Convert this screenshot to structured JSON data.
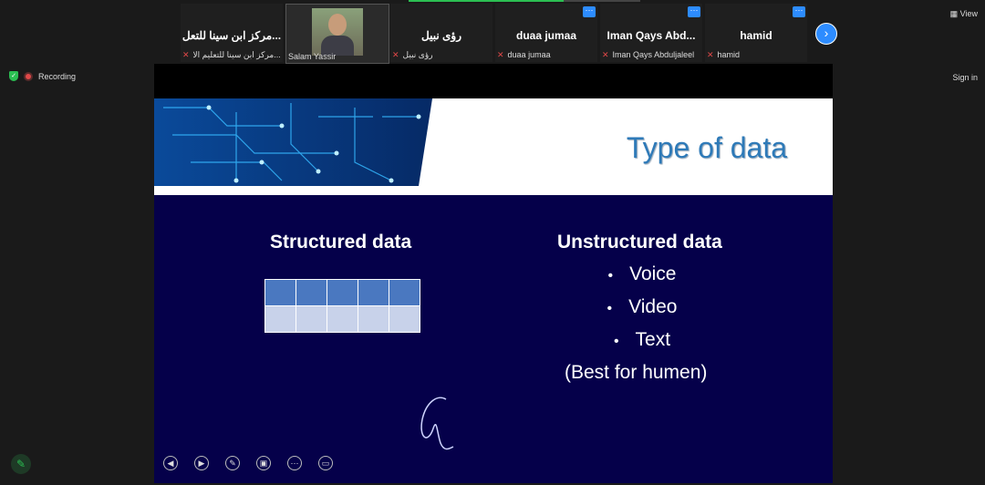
{
  "participants": [
    {
      "name": "مركز ابن سينا للتعل...",
      "label": "مركز ابن سينا للتعليم الا...",
      "has_video": false,
      "has_more": false
    },
    {
      "name": "",
      "label": "Salam Yassir",
      "has_video": true,
      "has_more": false
    },
    {
      "name": "رؤى نبيل",
      "label": "رؤى نبيل",
      "has_video": false,
      "has_more": false
    },
    {
      "name": "duaa jumaa",
      "label": "duaa jumaa",
      "has_video": false,
      "has_more": true
    },
    {
      "name": "Iman  Qays  Abd...",
      "label": "Iman Qays Abduljaleel",
      "has_video": false,
      "has_more": true
    },
    {
      "name": "hamid",
      "label": "hamid",
      "has_video": false,
      "has_more": true
    }
  ],
  "top": {
    "view_label": "View",
    "signin_label": "Sign in",
    "recording_label": "Recording"
  },
  "slide": {
    "title": "Type of data",
    "structured": {
      "title": "Structured data"
    },
    "unstructured": {
      "title": "Unstructured data",
      "items": [
        "Voice",
        "Video",
        "Text"
      ],
      "note": "(Best for humen)"
    }
  },
  "icons": {
    "more": "···",
    "next": "›",
    "controls": [
      "prev-icon",
      "next-icon",
      "pen-icon",
      "pointer-icon",
      "more-icon",
      "screen-icon"
    ]
  },
  "colors": {
    "accent": "#2d8cff",
    "slide_bg": "#05004a",
    "title": "#2e7ab8",
    "green": "#2bbf52"
  }
}
